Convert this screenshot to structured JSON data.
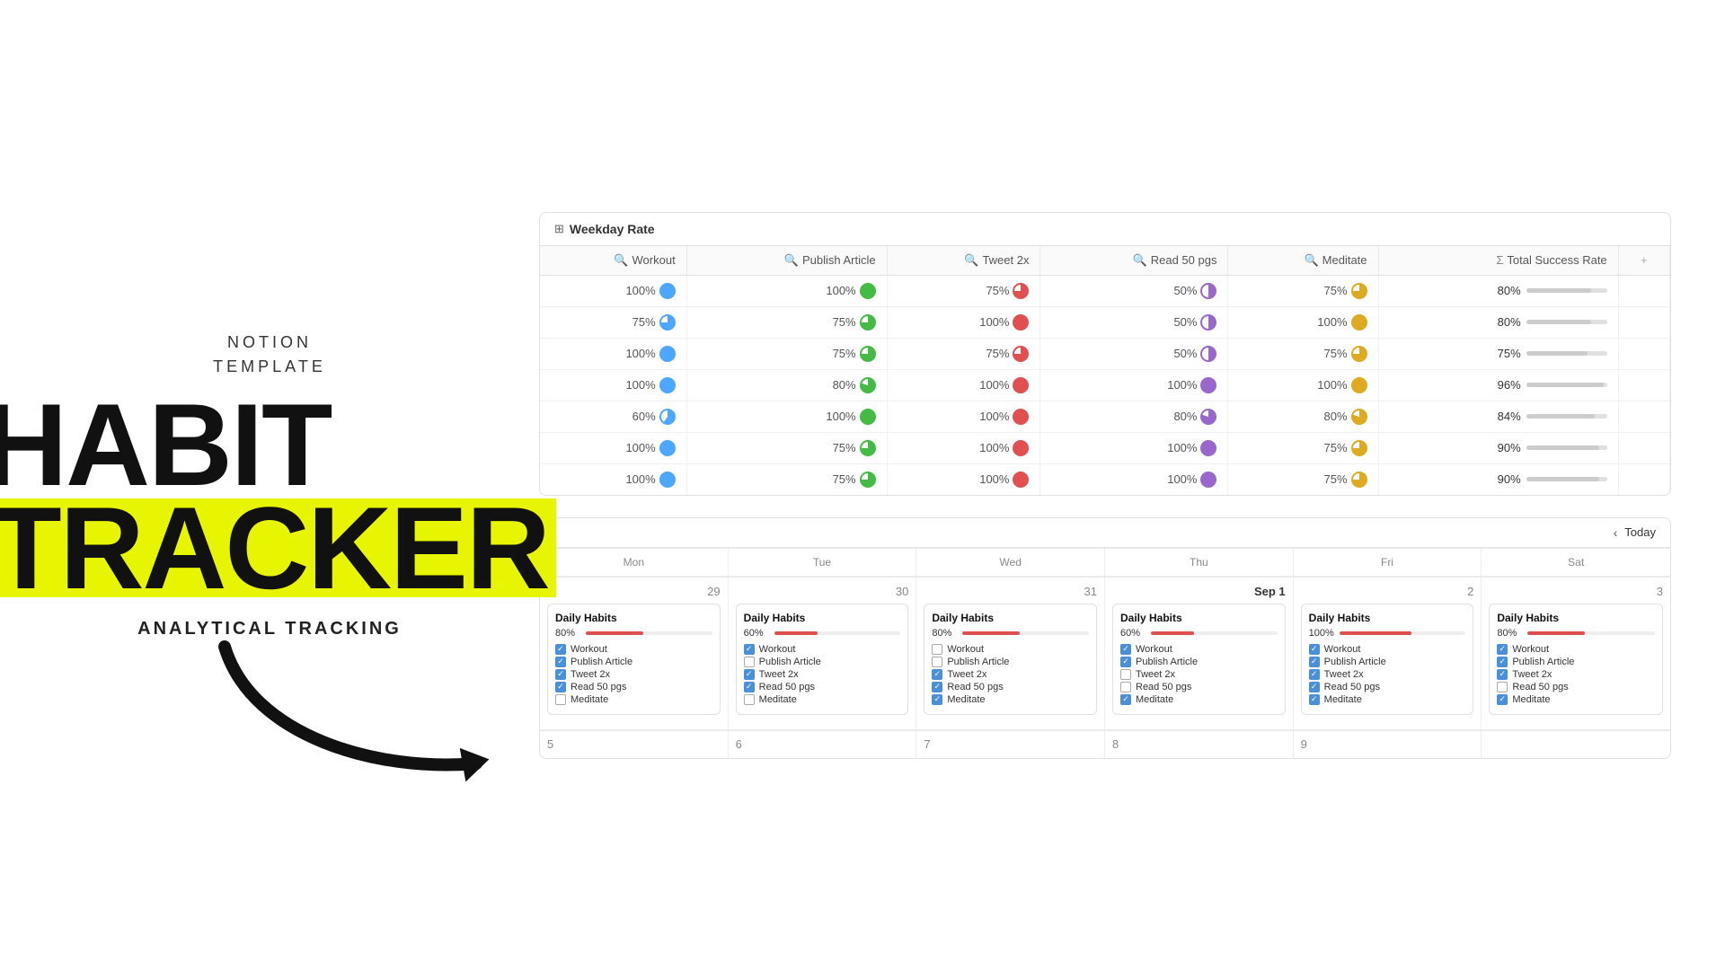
{
  "brand": {
    "line1": "NOTION",
    "line2": "TEMPLATE",
    "title1": "HABIT",
    "title2": "TRACKER",
    "subtitle": "ANALYTICAL TRACKING"
  },
  "table": {
    "header_title": "Weekday Rate",
    "columns": [
      {
        "label": "Workout",
        "icon": "🔍"
      },
      {
        "label": "Publish Article",
        "icon": "🔍"
      },
      {
        "label": "Tweet 2x",
        "icon": "🔍"
      },
      {
        "label": "Read 50 pgs",
        "icon": "🔍"
      },
      {
        "label": "Meditate",
        "icon": "🔍"
      },
      {
        "label": "Total Success Rate",
        "icon": "Σ"
      }
    ],
    "rows": [
      {
        "workout": "100%",
        "publish": "100%",
        "tweet": "75%",
        "read": "50%",
        "meditate": "75%",
        "total": "80%",
        "total_pct": 80
      },
      {
        "workout": "75%",
        "publish": "75%",
        "tweet": "100%",
        "read": "50%",
        "meditate": "100%",
        "total": "80%",
        "total_pct": 80
      },
      {
        "workout": "100%",
        "publish": "75%",
        "tweet": "75%",
        "read": "50%",
        "meditate": "75%",
        "total": "75%",
        "total_pct": 75
      },
      {
        "workout": "100%",
        "publish": "80%",
        "tweet": "100%",
        "read": "100%",
        "meditate": "100%",
        "total": "96%",
        "total_pct": 96
      },
      {
        "workout": "60%",
        "publish": "100%",
        "tweet": "100%",
        "read": "80%",
        "meditate": "80%",
        "total": "84%",
        "total_pct": 84
      },
      {
        "workout": "100%",
        "publish": "75%",
        "tweet": "100%",
        "read": "100%",
        "meditate": "75%",
        "total": "90%",
        "total_pct": 90
      },
      {
        "workout": "100%",
        "publish": "75%",
        "tweet": "100%",
        "read": "100%",
        "meditate": "75%",
        "total": "90%",
        "total_pct": 90
      }
    ]
  },
  "calendar": {
    "nav_today": "Today",
    "days": [
      "Mon",
      "Tue",
      "Wed",
      "Thu",
      "Fri",
      "Sat"
    ],
    "cells": [
      {
        "date": "29",
        "sep": false,
        "card_title": "Daily Habits",
        "pct": "80%",
        "pct_num": 80,
        "habits": [
          {
            "name": "Workout",
            "checked": true
          },
          {
            "name": "Publish Article",
            "checked": true
          },
          {
            "name": "Tweet 2x",
            "checked": true
          },
          {
            "name": "Read 50 pgs",
            "checked": true
          },
          {
            "name": "Meditate",
            "checked": false
          }
        ]
      },
      {
        "date": "30",
        "sep": false,
        "card_title": "Daily Habits",
        "pct": "60%",
        "pct_num": 60,
        "habits": [
          {
            "name": "Workout",
            "checked": true
          },
          {
            "name": "Publish Article",
            "checked": false
          },
          {
            "name": "Tweet 2x",
            "checked": true
          },
          {
            "name": "Read 50 pgs",
            "checked": true
          },
          {
            "name": "Meditate",
            "checked": false
          }
        ]
      },
      {
        "date": "31",
        "sep": false,
        "card_title": "Daily Habits",
        "pct": "80%",
        "pct_num": 80,
        "habits": [
          {
            "name": "Workout",
            "checked": false
          },
          {
            "name": "Publish Article",
            "checked": false
          },
          {
            "name": "Tweet 2x",
            "checked": true
          },
          {
            "name": "Read 50 pgs",
            "checked": true
          },
          {
            "name": "Meditate",
            "checked": true
          }
        ]
      },
      {
        "date": "Sep 1",
        "sep": true,
        "card_title": "Daily Habits",
        "pct": "60%",
        "pct_num": 60,
        "habits": [
          {
            "name": "Workout",
            "checked": true
          },
          {
            "name": "Publish Article",
            "checked": true
          },
          {
            "name": "Tweet 2x",
            "checked": false
          },
          {
            "name": "Read 50 pgs",
            "checked": false
          },
          {
            "name": "Meditate",
            "checked": true
          }
        ]
      },
      {
        "date": "2",
        "sep": false,
        "card_title": "Daily Habits",
        "pct": "100%",
        "pct_num": 100,
        "habits": [
          {
            "name": "Workout",
            "checked": true
          },
          {
            "name": "Publish Article",
            "checked": true
          },
          {
            "name": "Tweet 2x",
            "checked": true
          },
          {
            "name": "Read 50 pgs",
            "checked": true
          },
          {
            "name": "Meditate",
            "checked": true
          }
        ]
      },
      {
        "date": "3",
        "sep": false,
        "card_title": "Daily Habits",
        "pct": "80%",
        "pct_num": 80,
        "habits": [
          {
            "name": "Workout",
            "checked": true
          },
          {
            "name": "Publish Article",
            "checked": true
          },
          {
            "name": "Tweet 2x",
            "checked": true
          },
          {
            "name": "Read 50 pgs",
            "checked": false
          },
          {
            "name": "Meditate",
            "checked": true
          }
        ]
      }
    ],
    "bottom_dates": [
      "5",
      "6",
      "7",
      "8",
      "9",
      ""
    ]
  }
}
